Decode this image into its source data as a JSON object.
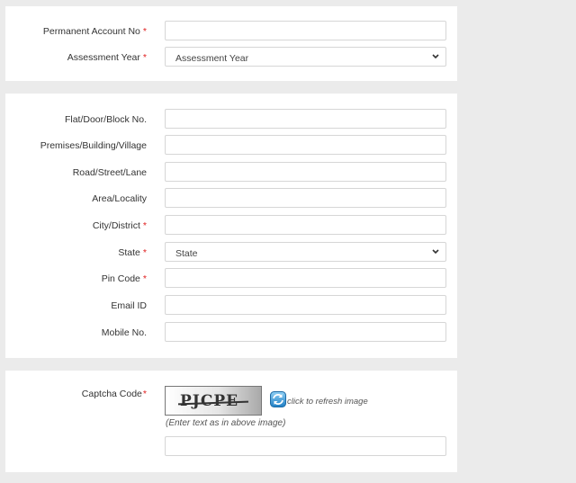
{
  "section_pan": {
    "pan_label": "Permanent Account No",
    "ay_label": "Assessment Year",
    "ay_selected": "Assessment Year",
    "required_mark": "*"
  },
  "section_address": {
    "flat_label": "Flat/Door/Block No.",
    "premises_label": "Premises/Building/Village",
    "road_label": "Road/Street/Lane",
    "area_label": "Area/Locality",
    "city_label": "City/District",
    "state_label": "State",
    "state_selected": "State",
    "pin_label": "Pin Code",
    "email_label": "Email ID",
    "mobile_label": "Mobile No.",
    "required_mark": "*"
  },
  "section_captcha": {
    "captcha_label": "Captcha Code",
    "required_mark": "*",
    "captcha_image_text": "PJCPE",
    "refresh_text": "click to refresh image",
    "hint_text": "(Enter text as in above image)"
  },
  "icons": {
    "refresh": "refresh-icon",
    "select_chevron": "chevron-down-icon"
  },
  "colors": {
    "background": "#ebebeb",
    "panel": "#ffffff",
    "required": "#e02020",
    "field_border": "#d6d6d6"
  }
}
